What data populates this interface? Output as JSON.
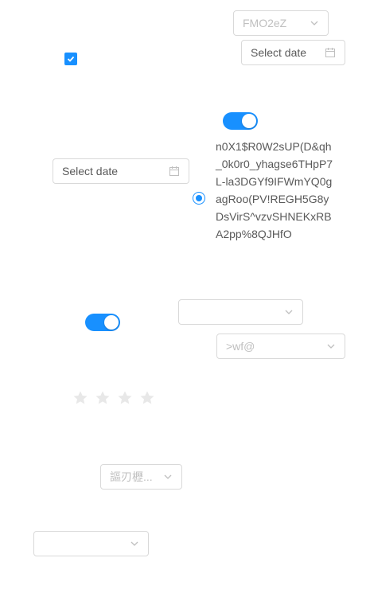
{
  "select_top": {
    "value": "FMO2eZ"
  },
  "date_top": {
    "placeholder": "Select date"
  },
  "date_left": {
    "placeholder": "Select date"
  },
  "radio": {
    "checked": true,
    "label": "n0X1$R0W2sUP(D&qh_0k0r0_yhagse6THpP7L-la3DGYf9IFWmYQ0gagRoo(PV!REGH5G8yDsVirS^vzvSHNEKxRBA2pp%8QJHfO"
  },
  "select_mid": {
    "value": ""
  },
  "select_mid_right": {
    "value": ">wf@"
  },
  "rate": {
    "value": 0,
    "count": 4
  },
  "select_cjk": {
    "value": "謳刃櫪..."
  },
  "select_bottom": {
    "value": ""
  },
  "colors": {
    "accent": "#1890ff",
    "border": "#d9d9d9",
    "placeholder": "#bfbfbf",
    "star_empty": "#e8e8e8"
  }
}
